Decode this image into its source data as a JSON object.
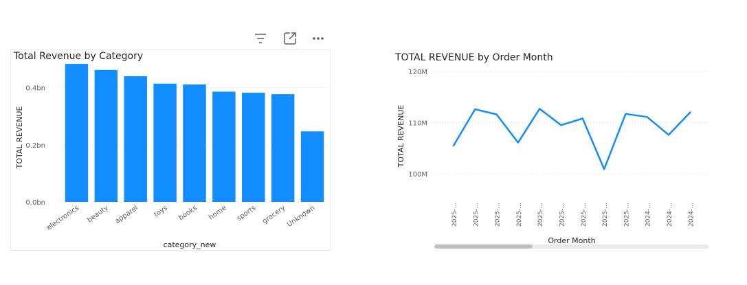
{
  "toolbar": {
    "icons": [
      "filter-icon",
      "focus-mode-icon",
      "more-options-icon"
    ]
  },
  "colors": {
    "bar": "#118DFF",
    "line": "#118DFF",
    "gridline": "#d9d9d9",
    "text": "#252423",
    "tick": "#605e5c",
    "scrollbar_track": "#ebebeb",
    "scrollbar_thumb": "#bfbfbf"
  },
  "chart_data": [
    {
      "type": "bar",
      "title": "Total Revenue by Category",
      "xlabel": "category_new",
      "ylabel": "TOTAL REVENUE",
      "categories": [
        "electronics",
        "beauty",
        "apparel",
        "toys",
        "books",
        "home",
        "sports",
        "grocery",
        "Unknown"
      ],
      "values": [
        0.483,
        0.462,
        0.44,
        0.414,
        0.411,
        0.386,
        0.382,
        0.377,
        0.247
      ],
      "value_unit": "bn",
      "yticks": [
        {
          "value": 0,
          "label": "0.0bn"
        },
        {
          "value": 0.2,
          "label": "0.2bn"
        },
        {
          "value": 0.4,
          "label": "0.4bn"
        }
      ],
      "ylim": [
        0,
        0.5
      ],
      "grid": true,
      "legend": "none"
    },
    {
      "type": "line",
      "title": "TOTAL REVENUE by Order Month",
      "xlabel": "Order Month",
      "ylabel": "TOTAL REVENUE",
      "x": [
        "2025-…",
        "2025-…",
        "2025-…",
        "2025-…",
        "2025-…",
        "2025-…",
        "2025-…",
        "2025-…",
        "2025-…",
        "2024-…",
        "2024-…",
        "2024-…"
      ],
      "values": [
        105.5,
        112.6,
        111.6,
        106.1,
        112.7,
        109.5,
        110.8,
        100.9,
        111.7,
        111.1,
        107.6,
        112.0
      ],
      "value_unit": "M",
      "yticks": [
        {
          "value": 100,
          "label": "100M"
        },
        {
          "value": 110,
          "label": "110M"
        },
        {
          "value": 120,
          "label": "120M"
        }
      ],
      "ylim": [
        95.2,
        120
      ],
      "grid": true,
      "legend": "none",
      "scrollbar": true
    }
  ]
}
